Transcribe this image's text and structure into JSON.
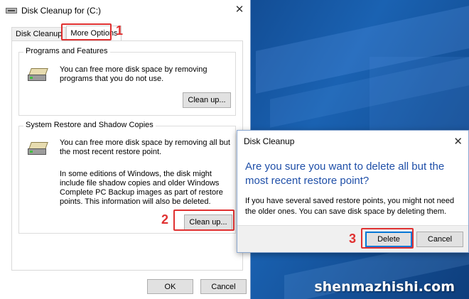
{
  "window": {
    "title": "Disk Cleanup for  (C:)",
    "close_glyph": "✕",
    "tabs": [
      {
        "label": "Disk Cleanup"
      },
      {
        "label": "More Options"
      }
    ],
    "programs": {
      "group_label": "Programs and Features",
      "text": "You can free more disk space by removing programs that you do not use.",
      "button": "Clean up...",
      "icon": "drive-icon"
    },
    "restore": {
      "group_label": "System Restore and Shadow Copies",
      "text": "You can free more disk space by removing all but the most recent restore point.",
      "text2": "In some editions of Windows, the disk might include file shadow copies and older Windows Complete PC Backup images as part of restore points. This information will also be deleted.",
      "button": "Clean up...",
      "icon": "drive-icon"
    },
    "ok": "OK",
    "cancel": "Cancel"
  },
  "dialog": {
    "title": "Disk Cleanup",
    "close_glyph": "✕",
    "heading": "Are you sure you want to delete all but the most recent restore point?",
    "body": "If you have several saved restore points, you might not need the older ones. You can save disk space by deleting them.",
    "delete": "Delete",
    "cancel": "Cancel"
  },
  "annotations": {
    "step1": "1",
    "step2": "2",
    "step3": "3",
    "highlight_color": "#e03131"
  },
  "watermark": "shenmazhishi.com"
}
